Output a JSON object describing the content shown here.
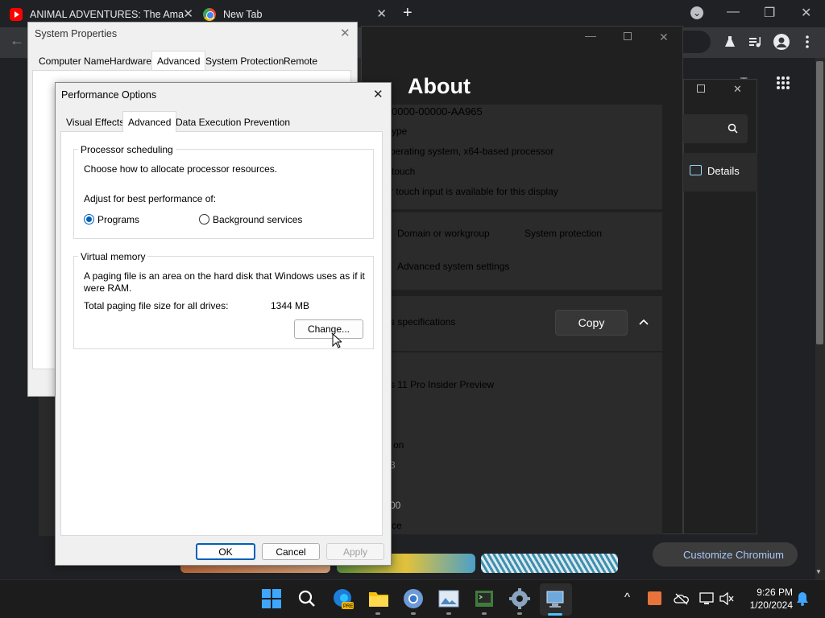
{
  "chrome": {
    "tabs": [
      {
        "title": "ANIMAL ADVENTURES: The Ama",
        "close": "✕"
      },
      {
        "title": "New Tab",
        "close": "✕"
      }
    ],
    "new_tab": "+",
    "tab_search": "⌄",
    "minimize": "—",
    "restore": "❐",
    "close": "✕",
    "back": "←",
    "customize": "Customize Chromium"
  },
  "settings": {
    "page_title": "About",
    "device_id_partial": "0000-00000-AA965",
    "system_type_label": "ype",
    "system_type_value": "perating system, x64-based processor",
    "pen_touch_label": "touch",
    "pen_touch_value": "r touch input is available for this display",
    "related_links": [
      "Domain or workgroup",
      "System protection",
      "Advanced system settings"
    ],
    "windows_specs_label": "s specifications",
    "copy_button": "Copy",
    "edition_value": "s 11 Pro Insider Preview",
    "version_label": "on",
    "install_value": "3",
    "build_value": "00",
    "experience_label": "ce"
  },
  "popup": {
    "details_label": "Details"
  },
  "system_properties": {
    "title": "System Properties",
    "close": "✕",
    "tabs": [
      "Computer Name",
      "Hardware",
      "Advanced",
      "System Protection",
      "Remote"
    ],
    "active_tab": "Advanced"
  },
  "performance_options": {
    "title": "Performance Options",
    "close": "✕",
    "tabs": [
      "Visual Effects",
      "Advanced",
      "Data Execution Prevention"
    ],
    "active_tab": "Advanced",
    "processor": {
      "group_label": "Processor scheduling",
      "description": "Choose how to allocate processor resources.",
      "adjust_label": "Adjust for best performance of:",
      "option_programs": "Programs",
      "option_background": "Background services",
      "selected": "Programs"
    },
    "virtual_memory": {
      "group_label": "Virtual memory",
      "description_line1": "A paging file is an area on the hard disk that Windows uses as if it",
      "description_line2": "were RAM.",
      "total_label": "Total paging file size for all drives:",
      "total_value": "1344 MB",
      "change_button": "Change..."
    },
    "buttons": {
      "ok": "OK",
      "cancel": "Cancel",
      "apply": "Apply"
    }
  },
  "taskbar": {
    "time": "9:26 PM",
    "date": "1/20/2024",
    "show_hidden": "^"
  },
  "colors": {
    "accent": "#005fb8",
    "settings_link": "#99d6ff",
    "dark_bg": "#202020"
  }
}
